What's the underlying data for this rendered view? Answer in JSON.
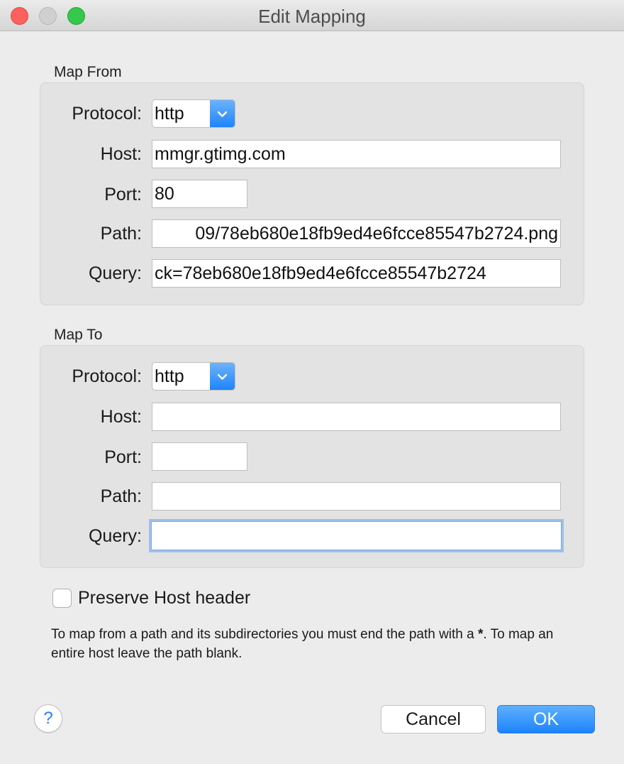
{
  "window": {
    "title": "Edit Mapping"
  },
  "map_from": {
    "section_label": "Map From",
    "protocol_label": "Protocol:",
    "protocol_value": "http",
    "host_label": "Host:",
    "host_value": "mmgr.gtimg.com",
    "port_label": "Port:",
    "port_value": "80",
    "path_label": "Path:",
    "path_value": "09/78eb680e18fb9ed4e6fcce85547b2724.png",
    "query_label": "Query:",
    "query_value": "ck=78eb680e18fb9ed4e6fcce85547b2724"
  },
  "map_to": {
    "section_label": "Map To",
    "protocol_label": "Protocol:",
    "protocol_value": "http",
    "host_label": "Host:",
    "host_value": "",
    "port_label": "Port:",
    "port_value": "",
    "path_label": "Path:",
    "path_value": "",
    "query_label": "Query:",
    "query_value": ""
  },
  "options": {
    "preserve_host_label": "Preserve Host header",
    "preserve_host_checked": false
  },
  "hint": {
    "part1": "To map from a path and its subdirectories you must end the path with a ",
    "bold": "*",
    "part2": ". To map an entire host leave the path blank."
  },
  "buttons": {
    "help": "?",
    "cancel": "Cancel",
    "ok": "OK"
  },
  "colors": {
    "accent": "#1c84fb",
    "close": "#fc615d",
    "maximize": "#35c84a",
    "focus_ring": "#9ec0ea"
  },
  "icons": {
    "dropdown": "chevron-down-icon",
    "help": "help-icon"
  }
}
